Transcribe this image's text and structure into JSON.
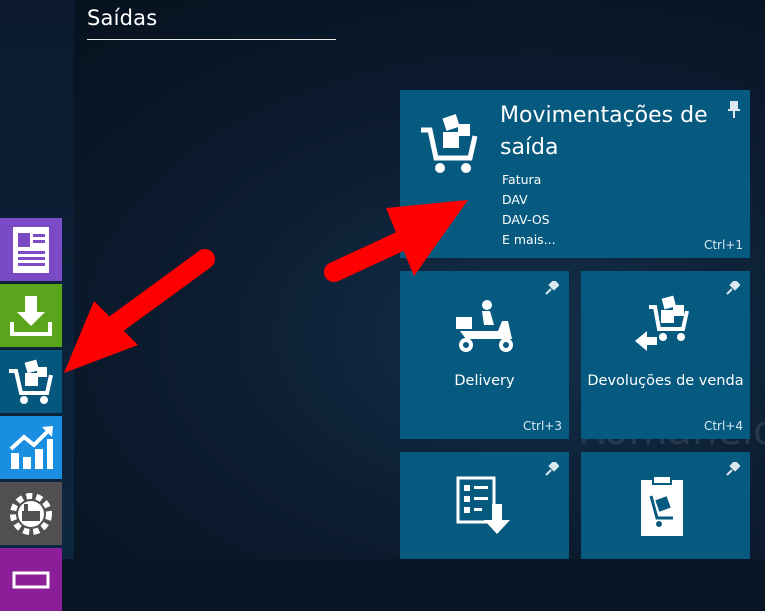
{
  "page": {
    "title": "Saídas"
  },
  "tiles": {
    "main": {
      "title": "Movimentações de saída",
      "items": [
        "Fatura",
        "DAV",
        "DAV-OS",
        "E mais..."
      ],
      "shortcut": "Ctrl+1",
      "icon": "shopping-cart-boxes-icon"
    },
    "delivery": {
      "label": "Delivery",
      "shortcut": "Ctrl+3",
      "icon": "scooter-delivery-icon"
    },
    "returns": {
      "label": "Devoluções de venda",
      "shortcut": "Ctrl+4",
      "icon": "cart-return-icon"
    },
    "orders": {
      "icon": "checklist-download-icon"
    },
    "romaneio": {
      "icon": "clipboard-handtruck-icon"
    }
  },
  "rail": [
    {
      "name": "document-icon",
      "color": "#7a4bc4"
    },
    {
      "name": "download-cart-icon",
      "color": "#5ba51d"
    },
    {
      "name": "shopping-cart-boxes-icon",
      "color": "#06577e"
    },
    {
      "name": "growth-chart-icon",
      "color": "#1a8ee0"
    },
    {
      "name": "gear-factory-icon",
      "color": "#505050"
    },
    {
      "name": "monitor-icon",
      "color": "#8d1e9a"
    }
  ],
  "background_text": "Romaneio",
  "colors": {
    "tile": "#065a80",
    "arrow": "#ff0000"
  }
}
